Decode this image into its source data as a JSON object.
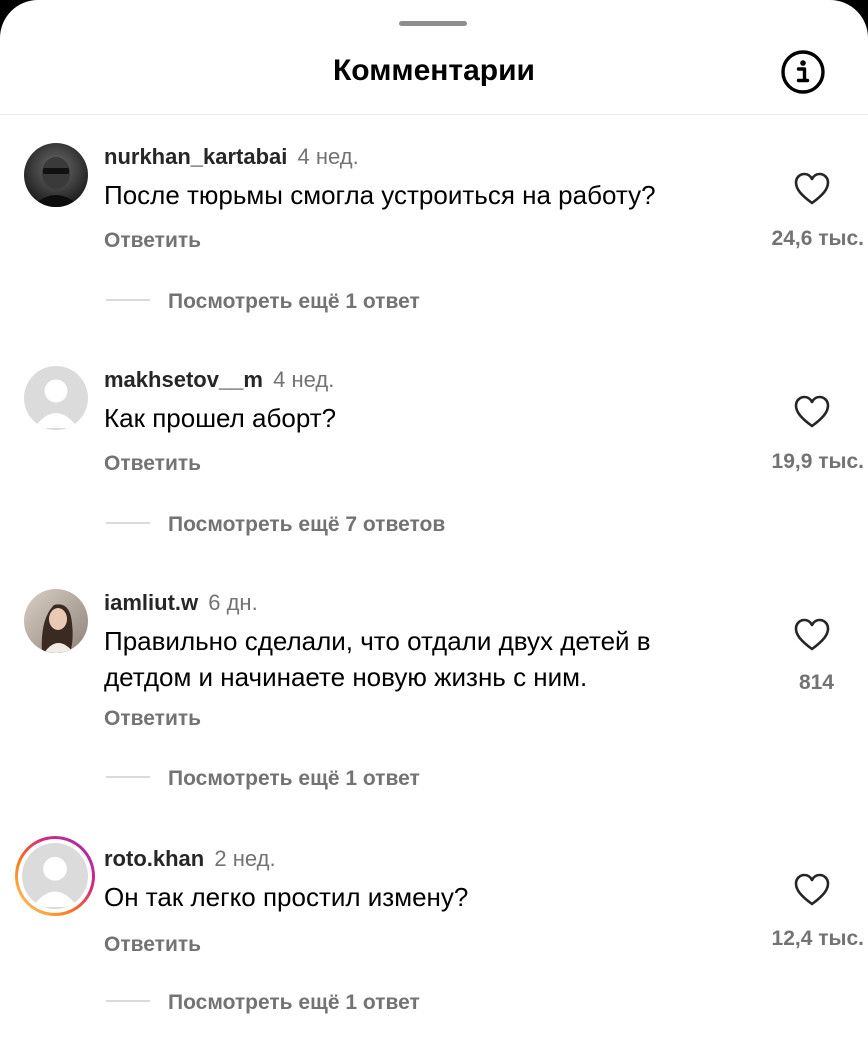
{
  "header": {
    "title": "Комментарии"
  },
  "comments": [
    {
      "username": "nurkhan_kartabai",
      "time": "4 нед.",
      "text": "После тюрьмы смогла устроиться на работу?",
      "reply_label": "Ответить",
      "likes": "24,6 тыс.",
      "view_more": "Посмотреть ещё 1 ответ",
      "avatar": "photo-dark"
    },
    {
      "username": "makhsetov__m",
      "time": "4 нед.",
      "text": "Как прошел аборт?",
      "reply_label": "Ответить",
      "likes": "19,9 тыс.",
      "view_more": "Посмотреть ещё 7 ответов",
      "avatar": "default-user"
    },
    {
      "username": "iamliut.w",
      "time": "6 дн.",
      "text": "Правильно сделали, что отдали двух детей в детдом и начинаете новую жизнь с ним.",
      "reply_label": "Ответить",
      "likes": "814",
      "view_more": "Посмотреть ещё 1 ответ",
      "avatar": "photo-light"
    },
    {
      "username": "roto.khan",
      "time": "2 нед.",
      "text": "Он так легко простил измену?",
      "reply_label": "Ответить",
      "likes": "12,4 тыс.",
      "view_more": "Посмотреть ещё 1 ответ",
      "avatar": "default-user-story-ring"
    }
  ],
  "icons": {
    "info": "info-icon",
    "like": "heart-outline-icon"
  },
  "colors": {
    "secondary_text": "#737373",
    "story_ring": [
      "#feda75",
      "#fa7e1e",
      "#d62976",
      "#962fbf"
    ]
  }
}
